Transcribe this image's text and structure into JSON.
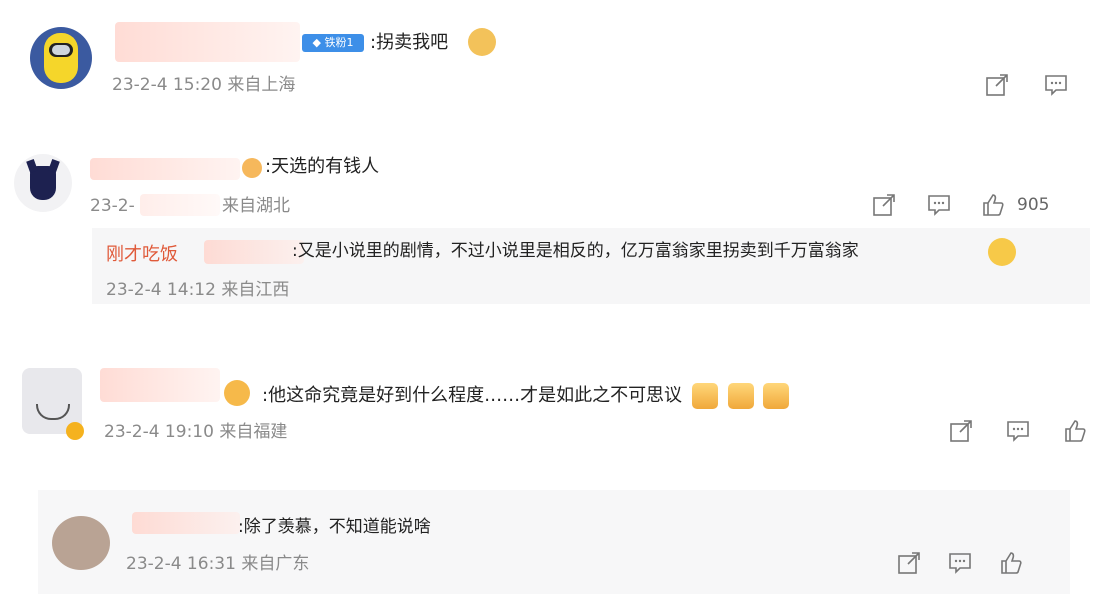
{
  "colors": {
    "meta": "#8a8a8a",
    "reply_author": "#e05a3a",
    "badge": "#3d8fe8"
  },
  "comments": [
    {
      "badge": "铁粉1",
      "text": ":拐卖我吧",
      "meta": "23-2-4 15:20 来自上海"
    },
    {
      "text": ":天选的有钱人",
      "meta": "23-2-",
      "meta_tail": "来自湖北",
      "likes": "905",
      "reply": {
        "author": "刚才吃饭",
        "text": ":又是小说里的剧情，不过小说里是相反的，亿万富翁家里拐卖到千万富翁家",
        "meta": "23-2-4 14:12 来自江西"
      }
    },
    {
      "text": ":他这命究竟是好到什么程度……才是如此之不可思议",
      "meta": "23-2-4 19:10 来自福建"
    },
    {
      "text": ":除了羡慕，不知道能说啥",
      "meta": "23-2-4 16:31 来自广东"
    }
  ],
  "icons": [
    "share-icon",
    "comment-icon",
    "like-icon"
  ]
}
